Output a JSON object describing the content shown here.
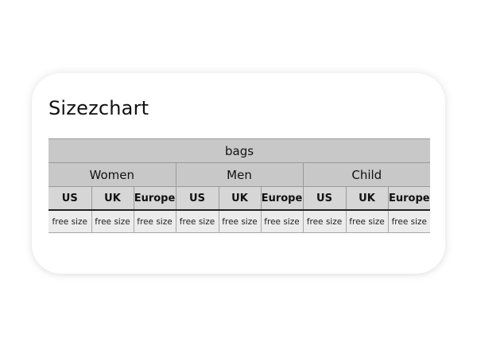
{
  "title": "Sizezchart",
  "table": {
    "category": "bags",
    "groups": [
      {
        "name": "Women",
        "columns": [
          "US",
          "UK",
          "Europe"
        ],
        "values": [
          "free size",
          "free size",
          "free size"
        ]
      },
      {
        "name": "Men",
        "columns": [
          "US",
          "UK",
          "Europe"
        ],
        "values": [
          "free size",
          "free size",
          "free size"
        ]
      },
      {
        "name": "Child",
        "columns": [
          "US",
          "UK",
          "Europe"
        ],
        "values": [
          "free size",
          "free size",
          "free size"
        ]
      }
    ]
  },
  "colors": {
    "header_bg": "#c8c8c8",
    "subheader_bg": "#d6d6d6",
    "value_bg": "#ececec",
    "text": "#111111"
  }
}
